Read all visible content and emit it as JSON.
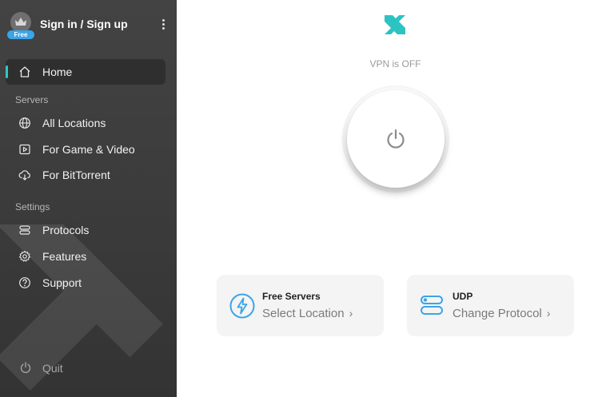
{
  "account": {
    "signin_label": "Sign in / Sign up",
    "badge": "Free"
  },
  "sidebar": {
    "items": [
      {
        "label": "Home",
        "icon": "home-icon",
        "active": true
      },
      {
        "label": "All Locations",
        "icon": "globe-icon"
      },
      {
        "label": "For Game & Video",
        "icon": "play-icon"
      },
      {
        "label": "For BitTorrent",
        "icon": "cloud-download-icon"
      },
      {
        "label": "Protocols",
        "icon": "protocol-icon"
      },
      {
        "label": "Features",
        "icon": "gear-icon"
      },
      {
        "label": "Support",
        "icon": "help-icon"
      }
    ],
    "sections": {
      "servers": "Servers",
      "settings": "Settings"
    },
    "quit_label": "Quit"
  },
  "main": {
    "status": "VPN is OFF",
    "server_card": {
      "title": "Free Servers",
      "subtitle": "Select Location"
    },
    "protocol_card": {
      "title": "UDP",
      "subtitle": "Change Protocol"
    }
  },
  "colors": {
    "accent": "#32c6c6",
    "brand_blue": "#3aa5e8",
    "sidebar_bg": "#3e3e3e"
  }
}
